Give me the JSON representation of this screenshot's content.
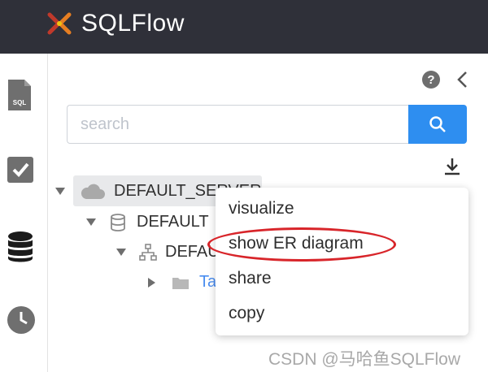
{
  "header": {
    "app_title": "SQLFlow",
    "background": "#2f3039"
  },
  "rail": {
    "items": [
      {
        "icon": "sql-file-icon",
        "label": "SQL"
      },
      {
        "icon": "checkbox-icon"
      },
      {
        "icon": "database-icon"
      },
      {
        "icon": "clock-icon"
      }
    ]
  },
  "panel": {
    "help_icon": "question-circle-icon",
    "collapse_icon": "chevron-left-icon"
  },
  "search": {
    "placeholder": "search",
    "value": "",
    "button_icon": "search-icon",
    "accent": "#2e8ef0"
  },
  "toolbar": {
    "download_icon": "download-icon"
  },
  "tree": {
    "server": {
      "label": "DEFAULT_SERVER",
      "icon": "cloud-icon"
    },
    "database": {
      "label": "DEFAULT",
      "icon": "database-icon"
    },
    "schema": {
      "label": "DEFAULT",
      "icon": "hierarchy-icon"
    },
    "tables": {
      "label": "Tables",
      "icon": "folder-icon"
    }
  },
  "context_menu": {
    "items": [
      "visualize",
      "show ER diagram",
      "share",
      "copy"
    ],
    "highlighted_item": "show ER diagram",
    "highlight_color": "#d8252a"
  },
  "watermark": {
    "text": "CSDN @马哈鱼SQLFlow"
  }
}
